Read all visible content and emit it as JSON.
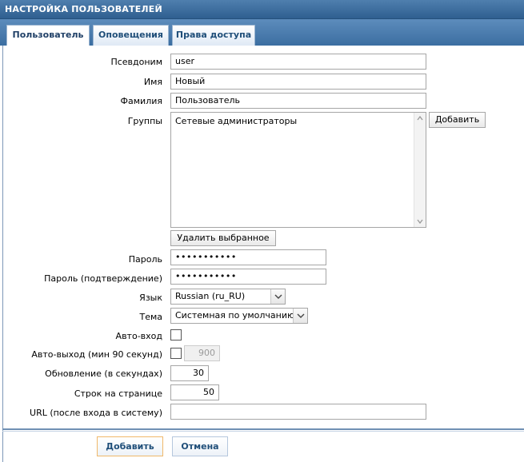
{
  "header": {
    "title": "НАСТРОЙКА ПОЛЬЗОВАТЕЛЕЙ"
  },
  "tabs": [
    {
      "label": "Пользователь",
      "active": true
    },
    {
      "label": "Оповещения",
      "active": false
    },
    {
      "label": "Права доступа",
      "active": false
    }
  ],
  "form": {
    "alias": {
      "label": "Псевдоним",
      "value": "user"
    },
    "name": {
      "label": "Имя",
      "value": "Новый"
    },
    "surname": {
      "label": "Фамилия",
      "value": "Пользователь"
    },
    "groups": {
      "label": "Группы",
      "items": [
        "Сетевые администраторы"
      ],
      "add_button": "Добавить",
      "remove_button": "Удалить выбранное"
    },
    "password": {
      "label": "Пароль",
      "value": "•••••••••••"
    },
    "password_confirm": {
      "label": "Пароль (подтверждение)",
      "value": "•••••••••••"
    },
    "language": {
      "label": "Язык",
      "value": "Russian (ru_RU)"
    },
    "theme": {
      "label": "Тема",
      "value": "Системная по умолчанию"
    },
    "autologin": {
      "label": "Авто-вход",
      "checked": false
    },
    "autologout": {
      "label": "Авто-выход (мин 90 секунд)",
      "checked": false,
      "value": "900"
    },
    "refresh": {
      "label": "Обновление (в секундах)",
      "value": "30"
    },
    "rows_per_page": {
      "label": "Строк на странице",
      "value": "50"
    },
    "url": {
      "label": "URL (после входа в систему)",
      "value": ""
    }
  },
  "footer": {
    "add_button": "Добавить",
    "cancel_button": "Отмена"
  },
  "icons": {
    "select_arrow": "chevron-down-icon",
    "scroll_up": "arrow-up-icon",
    "scroll_down": "arrow-down-icon"
  },
  "colors": {
    "header_blue": "#3b6ea1",
    "tab_text": "#1f4e79",
    "primary_border": "#f0b86a"
  }
}
